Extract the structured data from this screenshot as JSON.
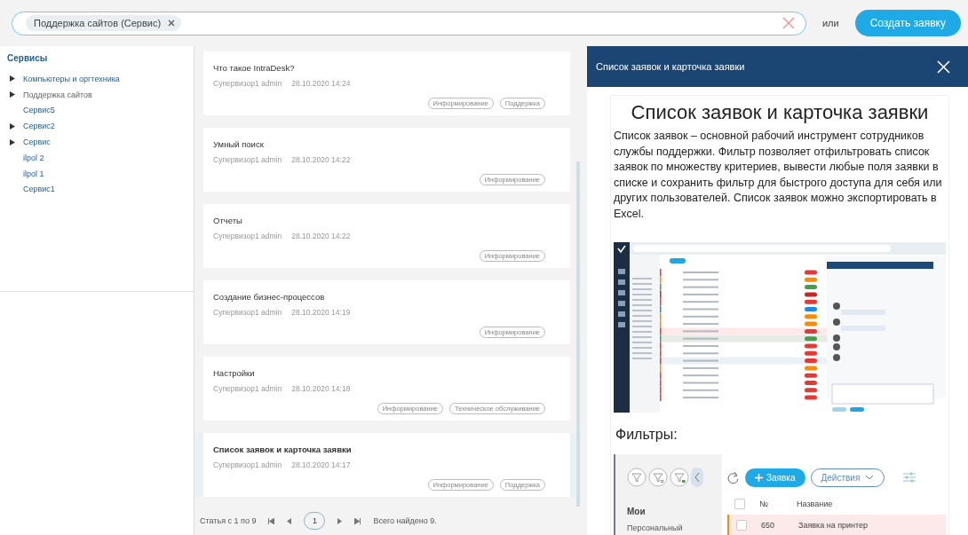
{
  "search": {
    "chip": "Поддержка сайтов (Сервис)"
  },
  "or_label": "или",
  "create_button": "Создать заявку",
  "sidebar": {
    "title": "Сервисы",
    "items": [
      {
        "label": "Компьютеры и оргтехника",
        "kind": "folder",
        "selected": false
      },
      {
        "label": "Поддержка сайтов",
        "kind": "folder",
        "selected": true
      },
      {
        "label": "Сервис5",
        "kind": "leaf",
        "selected": false
      },
      {
        "label": "Сервис2",
        "kind": "folder",
        "selected": false
      },
      {
        "label": "Сервис",
        "kind": "folder",
        "selected": false
      },
      {
        "label": "ilpol 2",
        "kind": "leaf",
        "selected": false
      },
      {
        "label": "ilpol 1",
        "kind": "leaf",
        "selected": false
      },
      {
        "label": "Сервис1",
        "kind": "leaf",
        "selected": false
      }
    ]
  },
  "articles": [
    {
      "title": "Что такое IntraDesk?",
      "author": "Супервизор1 admin",
      "date": "28.10.2020 14:24",
      "tags": [
        "Информирование",
        "Поддержка"
      ],
      "selected": false
    },
    {
      "title": "Умный поиск",
      "author": "Супервизор1 admin",
      "date": "28.10.2020 14:22",
      "tags": [
        "Информирование"
      ],
      "selected": false
    },
    {
      "title": "Отчеты",
      "author": "Супервизор1 admin",
      "date": "28.10.2020 14:22",
      "tags": [
        "Информирование"
      ],
      "selected": false
    },
    {
      "title": "Создание бизнес-процессов",
      "author": "Супервизор1 admin",
      "date": "28.10.2020 14:19",
      "tags": [
        "Информирование"
      ],
      "selected": false
    },
    {
      "title": "Настройки",
      "author": "Супервизор1 admin",
      "date": "28.10.2020 14:18",
      "tags": [
        "Информирование",
        "Техническое обслуживание"
      ],
      "selected": false
    },
    {
      "title": "Список заявок и карточка заявки",
      "author": "Супервизор1 admin",
      "date": "28.10.2020 14:17",
      "tags": [
        "Информирование",
        "Поддержка"
      ],
      "selected": true
    }
  ],
  "pagination": {
    "range": "Статья с 1 по 9",
    "page": "1",
    "total": "Всего найдено 9."
  },
  "reader": {
    "title": "Список заявок и карточка заявки",
    "heading": "Список заявок и карточка заявки",
    "paragraph": "Список заявок – основной рабочий инструмент сотрудников службы поддержки. Фильтр позволяет отфильтровать список заявок по множеству критериев, вывести любые поля заявки в списке и сохранить фильтр для быстрого доступа для себя или других пользователей. Список заявок можно экспортировать в Excel.",
    "subheading": "Фильтры:",
    "filters_screenshot": {
      "section": "Мои",
      "item": "Персональный",
      "new_button": "Заявка",
      "actions_button": "Действия",
      "columns": [
        "№",
        "Название"
      ],
      "header_checked": false,
      "rows": [
        {
          "number": "650",
          "name": "Заявка на принтер",
          "checked": false
        }
      ]
    }
  }
}
